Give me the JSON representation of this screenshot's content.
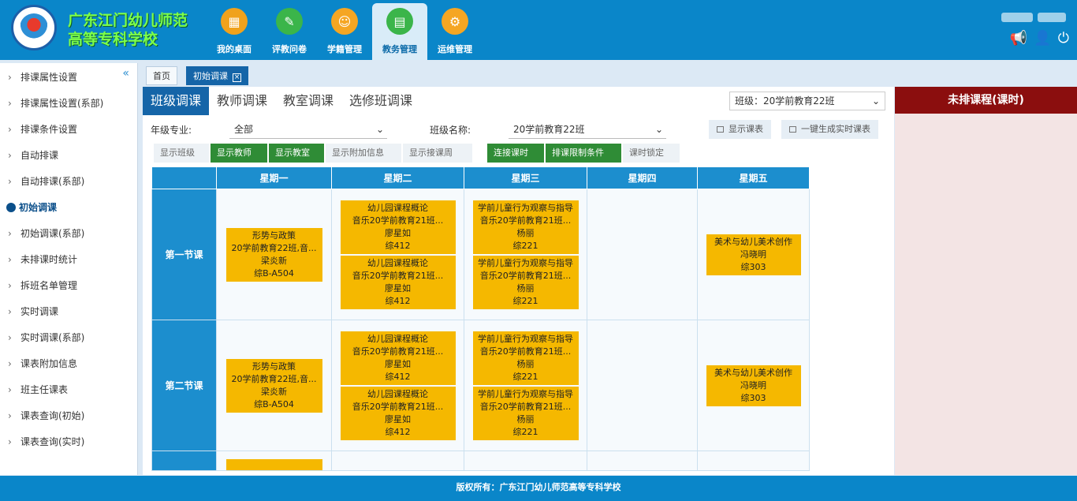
{
  "header": {
    "school_line1": "广东江门幼儿师范",
    "school_line2": "高等专科学校",
    "nav": [
      {
        "label": "我的桌面",
        "icon": "desktop-grid-icon",
        "color": "#f0a21c"
      },
      {
        "label": "评教问卷",
        "icon": "questionnaire-icon",
        "color": "#3bb54a"
      },
      {
        "label": "学籍管理",
        "icon": "student-records-icon",
        "color": "#f5a623"
      },
      {
        "label": "教务管理",
        "icon": "academic-affairs-icon",
        "color": "#3bb54a"
      },
      {
        "label": "运维管理",
        "icon": "operations-gear-icon",
        "color": "#f5a623"
      }
    ],
    "active_nav_index": 3,
    "icons": [
      "megaphone-icon",
      "user-icon",
      "power-icon"
    ]
  },
  "sidebar": {
    "items": [
      {
        "label": "排课属性设置",
        "active": false
      },
      {
        "label": "排课属性设置(系部)",
        "active": false
      },
      {
        "label": "排课条件设置",
        "active": false
      },
      {
        "label": "自动排课",
        "active": false
      },
      {
        "label": "自动排课(系部)",
        "active": false
      },
      {
        "label": "初始调课",
        "active": true
      },
      {
        "label": "初始调课(系部)",
        "active": false
      },
      {
        "label": "未排课时统计",
        "active": false
      },
      {
        "label": "拆班名单管理",
        "active": false
      },
      {
        "label": "实时调课",
        "active": false
      },
      {
        "label": "实时调课(系部)",
        "active": false
      },
      {
        "label": "课表附加信息",
        "active": false
      },
      {
        "label": "班主任课表",
        "active": false
      },
      {
        "label": "课表查询(初始)",
        "active": false
      },
      {
        "label": "课表查询(实时)",
        "active": false
      }
    ]
  },
  "tabs": {
    "home": "首页",
    "current": "初始调课"
  },
  "subtabs": [
    "班级调课",
    "教师调课",
    "教室调课",
    "选修班调课"
  ],
  "class_select": {
    "label": "班级：",
    "value": "20学前教育22班"
  },
  "filters": {
    "grade_label": "年级专业:",
    "grade_value": "全部",
    "class_label": "班级名称:",
    "class_value": "20学前教育22班",
    "show_schedule": "显示课表",
    "generate": "一键生成实时课表"
  },
  "toolbar": {
    "show_class": "显示班级",
    "show_teacher": "显示教师",
    "show_room": "显示教室",
    "show_extra": "显示附加信息",
    "show_weeks": "显示接课周",
    "link_hours": "连接课时",
    "constraints": "排课限制条件",
    "lock": "课时锁定"
  },
  "schedule": {
    "days": [
      "星期一",
      "星期二",
      "星期三",
      "星期四",
      "星期五"
    ],
    "periods": [
      {
        "label": "第一节课",
        "cells": [
          [
            {
              "l1": "形势与政策",
              "l2": "20学前教育22班,音...",
              "l3": "梁炎新",
              "l4": "综B-A504"
            }
          ],
          [
            {
              "l1": "幼儿园课程概论",
              "l2": "音乐20学前教育21班...",
              "l3": "廖星如",
              "l4": "综412"
            },
            {
              "l1": "幼儿园课程概论",
              "l2": "音乐20学前教育21班...",
              "l3": "廖星如",
              "l4": "综412"
            }
          ],
          [
            {
              "l1": "学前儿童行为观察与指导",
              "l2": "音乐20学前教育21班...",
              "l3": "杨丽",
              "l4": "综221"
            },
            {
              "l1": "学前儿童行为观察与指导",
              "l2": "音乐20学前教育21班...",
              "l3": "杨丽",
              "l4": "综221"
            }
          ],
          [],
          [
            {
              "l1": "美术与幼儿美术创作",
              "l2": "冯晓明",
              "l3": "综303",
              "l4": ""
            }
          ]
        ]
      },
      {
        "label": "第二节课",
        "cells": [
          [
            {
              "l1": "形势与政策",
              "l2": "20学前教育22班,音...",
              "l3": "梁炎新",
              "l4": "综B-A504"
            }
          ],
          [
            {
              "l1": "幼儿园课程概论",
              "l2": "音乐20学前教育21班...",
              "l3": "廖星如",
              "l4": "综412"
            },
            {
              "l1": "幼儿园课程概论",
              "l2": "音乐20学前教育21班...",
              "l3": "廖星如",
              "l4": "综412"
            }
          ],
          [
            {
              "l1": "学前儿童行为观察与指导",
              "l2": "音乐20学前教育21班...",
              "l3": "杨丽",
              "l4": "综221"
            },
            {
              "l1": "学前儿童行为观察与指导",
              "l2": "音乐20学前教育21班...",
              "l3": "杨丽",
              "l4": "综221"
            }
          ],
          [],
          [
            {
              "l1": "美术与幼儿美术创作",
              "l2": "冯晓明",
              "l3": "综303",
              "l4": ""
            }
          ]
        ]
      }
    ]
  },
  "unscheduled_title": "未排课程(课时)",
  "footer": "版权所有：广东江门幼儿师范高等专科学校"
}
